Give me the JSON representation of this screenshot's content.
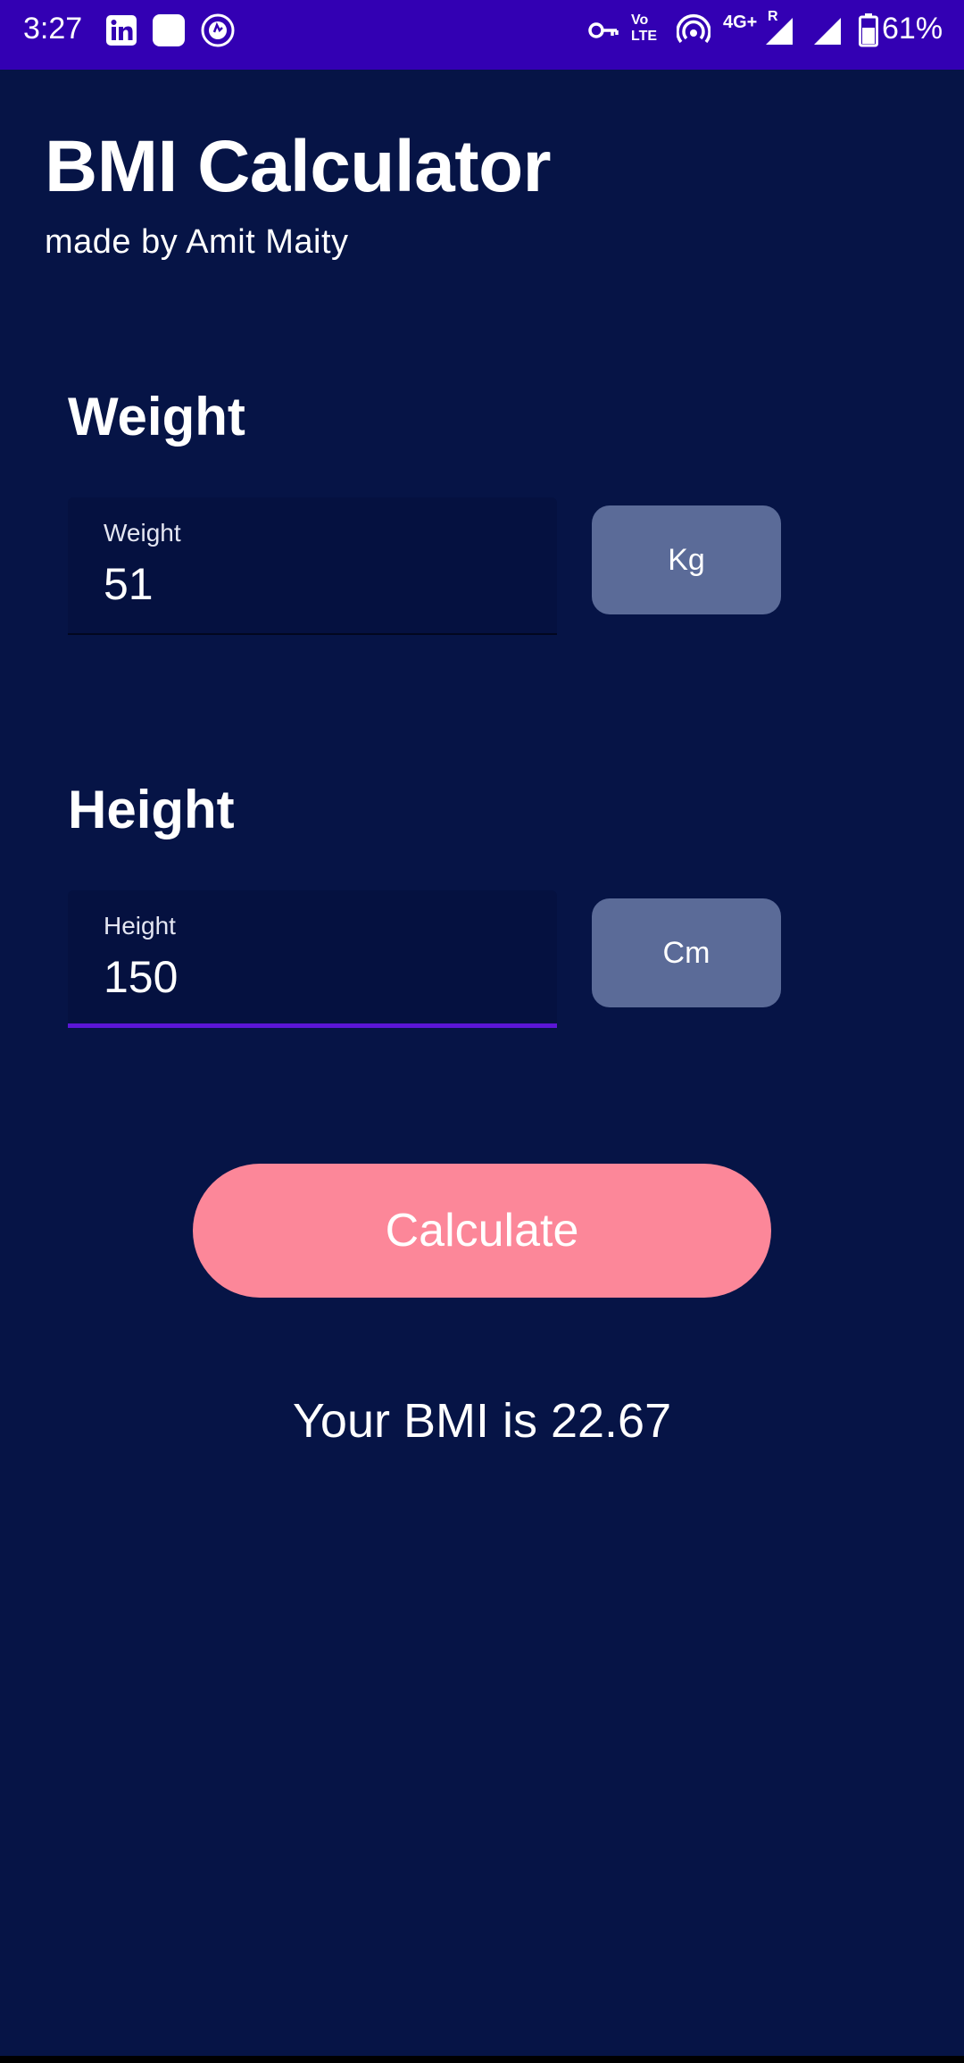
{
  "status_bar": {
    "time": "3:27",
    "network_small_top": "Vo",
    "network_small_bottom": "LTE",
    "network_type": "4G+",
    "roaming": "R",
    "battery": "61%",
    "background_color": "#3300b3",
    "icons": [
      "linkedin-icon",
      "app-square-icon",
      "vpn-shield-icon",
      "key-icon",
      "volte-icon",
      "hotspot-icon",
      "signal-4g-icon",
      "signal-icon",
      "battery-icon"
    ]
  },
  "header": {
    "title": "BMI Calculator",
    "subtitle": "made by Amit Maity"
  },
  "weight": {
    "section_title": "Weight",
    "field_label": "Weight",
    "field_value": "51",
    "unit_button": "Kg"
  },
  "height": {
    "section_title": "Height",
    "field_label": "Height",
    "field_value": "150",
    "unit_button": "Cm"
  },
  "calculate": {
    "label": "Calculate"
  },
  "result": {
    "text": "Your BMI is 22.67"
  },
  "colors": {
    "background": "#061446",
    "field_background": "#051140",
    "unit_button": "#5b6b98",
    "calculate_button": "#fc8799",
    "focus_underline": "#5b16d6"
  }
}
